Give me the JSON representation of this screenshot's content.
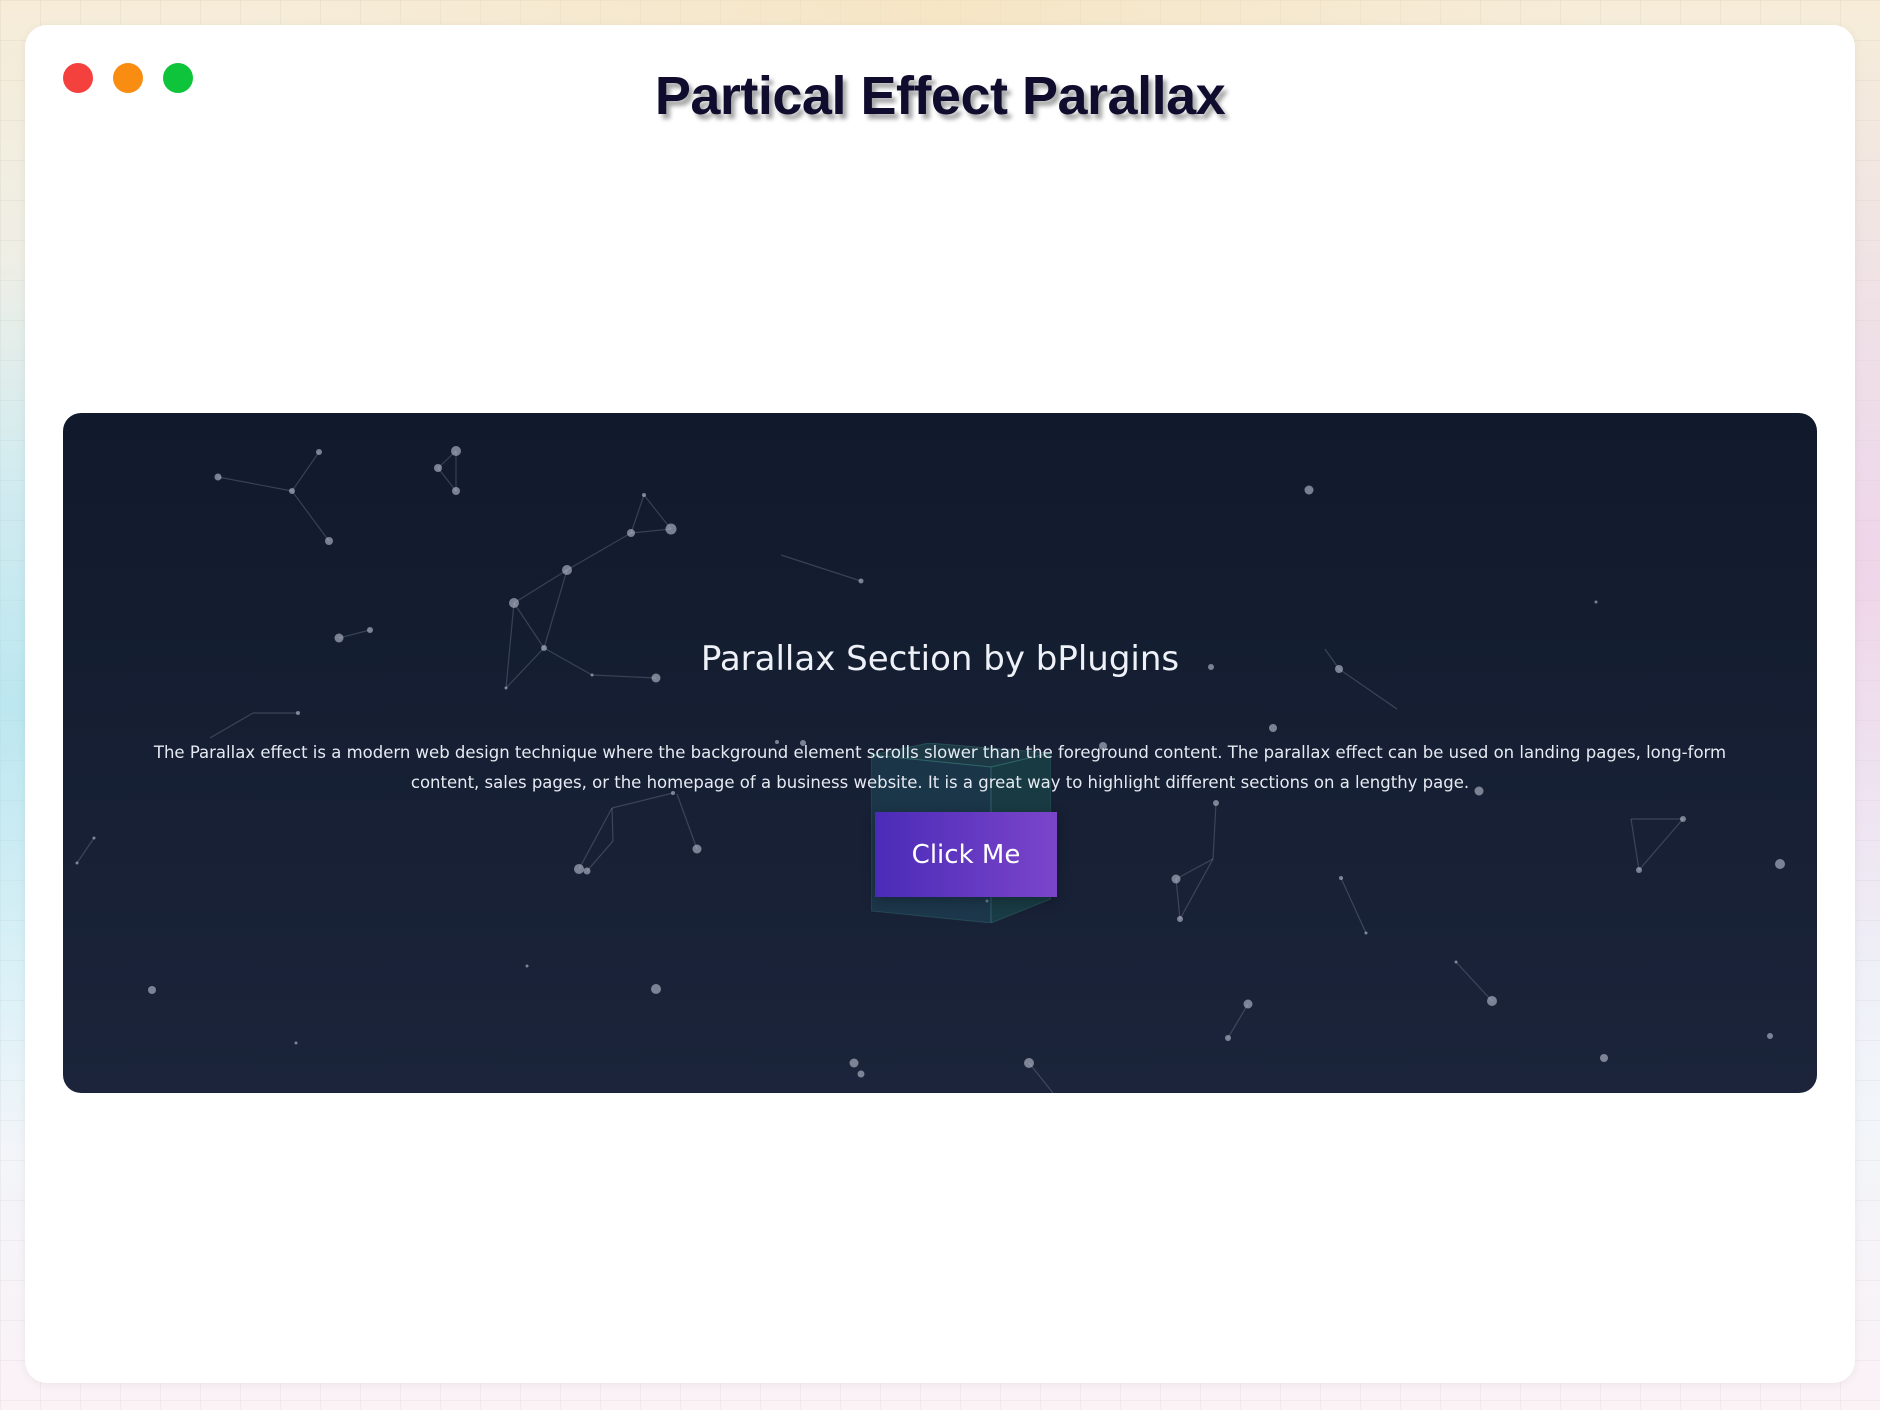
{
  "window": {
    "title": "Partical Effect Parallax",
    "controls": [
      {
        "name": "close",
        "color": "#f4413e"
      },
      {
        "name": "minimize",
        "color": "#f98d12"
      },
      {
        "name": "maximize",
        "color": "#0dc43b"
      }
    ]
  },
  "parallax_section": {
    "heading": "Parallax Section by bPlugins",
    "description": "The Parallax effect is a modern web design technique where the background element scrolls slower than the foreground content. The parallax effect can be used on landing pages, long-form content, sales pages, or the homepage of a business website. It is a great way to highlight different sections on a lengthy page.",
    "button_label": "Click Me"
  },
  "colors": {
    "section_bg_top": "#111a2c",
    "section_bg_bottom": "#1b243a",
    "button_gradient_start": "#4a2bb8",
    "button_gradient_end": "#7b45c9",
    "title_text": "#0f0c2e"
  }
}
